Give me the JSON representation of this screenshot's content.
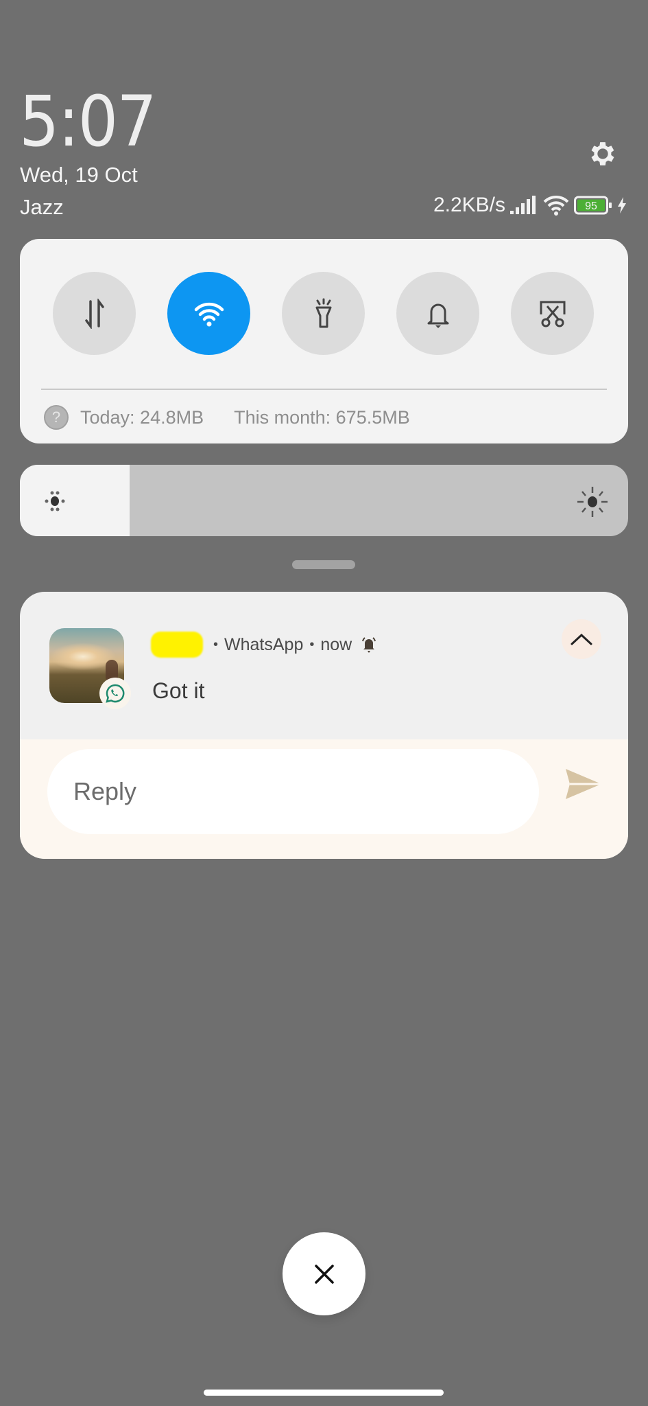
{
  "header": {
    "time": "5:07",
    "date": "Wed, 19 Oct",
    "carrier": "Jazz",
    "network_speed": "2.2KB/s",
    "battery_level": "95",
    "battery_percent": 95,
    "charging": true,
    "icons": [
      "gear-icon",
      "signal-icon",
      "wifi-icon",
      "battery-icon",
      "charging-bolt-icon"
    ]
  },
  "quick_settings": {
    "toggles": [
      {
        "name": "mobile-data",
        "icon": "data-arrows-icon",
        "active": false
      },
      {
        "name": "wifi",
        "icon": "wifi-icon",
        "active": true
      },
      {
        "name": "flashlight",
        "icon": "flashlight-icon",
        "active": false
      },
      {
        "name": "sound",
        "icon": "bell-icon",
        "active": false
      },
      {
        "name": "screenshot",
        "icon": "scissors-screenshot-icon",
        "active": false
      }
    ],
    "usage_today": "Today: 24.8MB",
    "usage_month": "This month: 675.5MB",
    "accent_color": "#0d96f2"
  },
  "brightness": {
    "level_fraction": 0.18
  },
  "notification": {
    "sender": "[redacted]",
    "app": "WhatsApp",
    "time": "now",
    "message": "Got it",
    "reply_placeholder": "Reply",
    "app_color": "#1f8a6e"
  }
}
